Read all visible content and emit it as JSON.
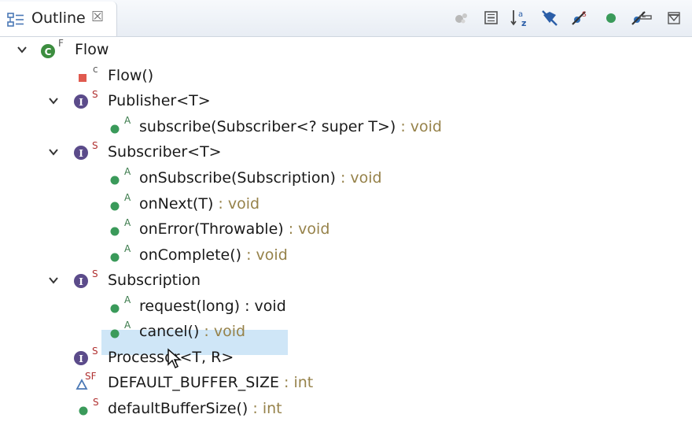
{
  "view": {
    "tab_label": "Outline",
    "tab_close": "☒",
    "tab_icon": "outline-view-icon"
  },
  "toolbar": {
    "icons": [
      "hide-non-public-icon",
      "collapse-all-icon",
      "sort-alphabetically-icon",
      "hide-fields-icon",
      "hide-static-icon",
      "hide-non-public-members-icon",
      "hide-local-types-icon",
      "view-menu-icon",
      "minimize-icon",
      "maximize-icon"
    ]
  },
  "tree": {
    "root": {
      "label": "Flow",
      "mod": "F",
      "kind": "class"
    },
    "constructor": {
      "label": "Flow()",
      "mod": "c"
    },
    "publisher": {
      "label": "Publisher<T>",
      "mod": "S",
      "methods": [
        {
          "name": "subscribe(Subscriber<? super T>)",
          "ret": " : void",
          "mod": "A"
        }
      ]
    },
    "subscriber": {
      "label": "Subscriber<T>",
      "mod": "S",
      "methods": [
        {
          "name": "onSubscribe(Subscription)",
          "ret": " : void",
          "mod": "A"
        },
        {
          "name": "onNext(T)",
          "ret": " : void",
          "mod": "A"
        },
        {
          "name": "onError(Throwable)",
          "ret": " : void",
          "mod": "A"
        },
        {
          "name": "onComplete()",
          "ret": " : void",
          "mod": "A"
        }
      ]
    },
    "subscription": {
      "label": "Subscription",
      "mod": "S",
      "methods": [
        {
          "name": "request(long)",
          "ret": " : void",
          "mod": "A",
          "selected": true
        },
        {
          "name": "cancel()",
          "ret": " : void",
          "mod": "A"
        }
      ]
    },
    "processor": {
      "label": "Processor<T, R>",
      "mod": "S"
    },
    "field": {
      "name": "DEFAULT_BUFFER_SIZE",
      "ret": " : int",
      "mod": "SF"
    },
    "method": {
      "name": "defaultBufferSize()",
      "ret": " : int",
      "mod": "S"
    }
  },
  "colors": {
    "class_green": "#3c8d3f",
    "interface_purple": "#5b4b8a",
    "method_green": "#3a9a5a",
    "private_red": "#e05a4f",
    "return_type": "#96824a",
    "selection": "#cfe6f7"
  }
}
